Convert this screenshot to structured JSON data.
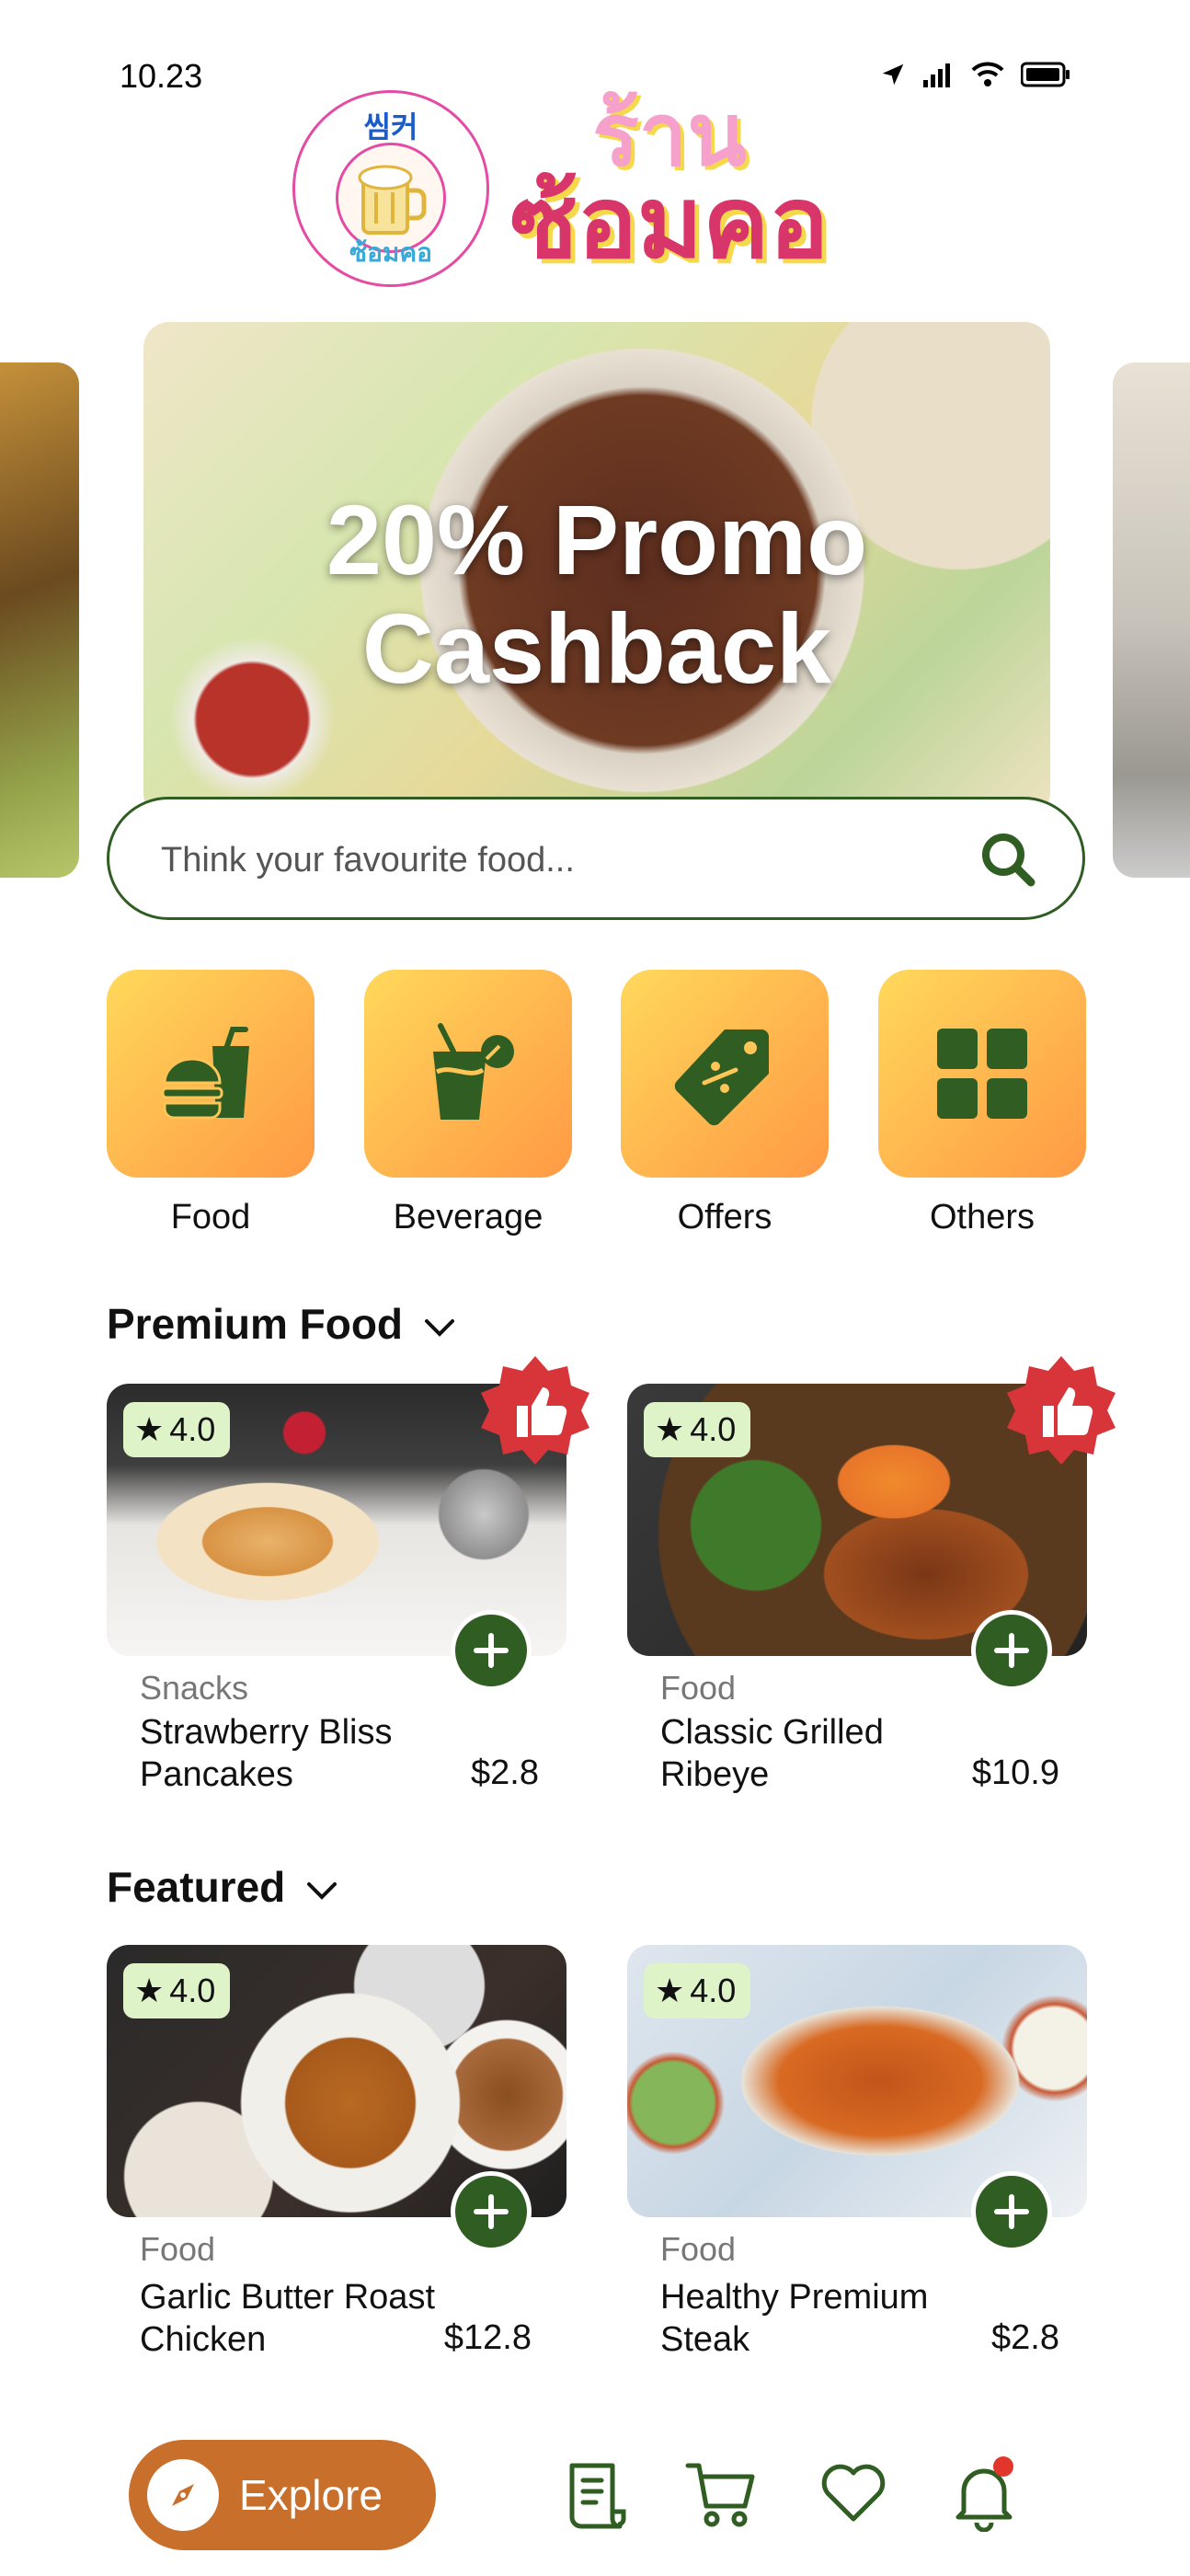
{
  "status": {
    "time": "10.23"
  },
  "logo": {
    "seal_top": "씸커",
    "seal_bottom": "ซ้อมคอ",
    "word_line1": "ร้าน",
    "word_line2": "ซ้อมคอ"
  },
  "banner": {
    "line1": "20% Promo",
    "line2": "Cashback"
  },
  "search": {
    "placeholder": "Think your favourite food..."
  },
  "categories": [
    {
      "label": "Food",
      "icon": "burger-drink-icon"
    },
    {
      "label": "Beverage",
      "icon": "juice-glass-icon"
    },
    {
      "label": "Offers",
      "icon": "price-tag-icon"
    },
    {
      "label": "Others",
      "icon": "grid-icon"
    }
  ],
  "premium": {
    "title": "Premium Food",
    "items": [
      {
        "rating": "4.0",
        "category": "Snacks",
        "name": "Strawberry Bliss Pancakes",
        "price": "$2.8"
      },
      {
        "rating": "4.0",
        "category": "Food",
        "name": "Classic Grilled Ribeye",
        "price": "$10.9"
      }
    ]
  },
  "featured": {
    "title": "Featured",
    "items": [
      {
        "rating": "4.0",
        "category": "Food",
        "name": "Garlic Butter Roast Chicken",
        "price": "$12.8"
      },
      {
        "rating": "4.0",
        "category": "Food",
        "name": "Healthy Premium Steak",
        "price": "$2.8"
      }
    ]
  },
  "nav": {
    "explore_label": "Explore"
  },
  "colors": {
    "primary_green": "#2f5d22",
    "accent_orange": "#c96f2c",
    "badge_red": "#d8353a",
    "rating_bg": "#dff3c8"
  }
}
